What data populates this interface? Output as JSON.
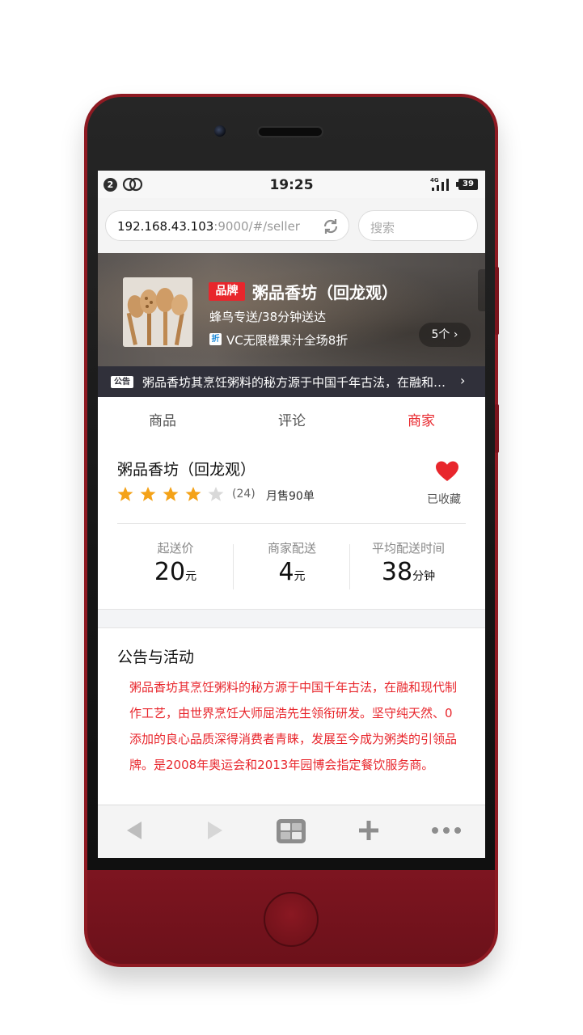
{
  "statusbar": {
    "notification_count": "2",
    "time": "19:25",
    "network": "4G",
    "battery": "39"
  },
  "addressbar": {
    "url_host": "192.168.43.103",
    "url_path": ":9000/#/seller",
    "search_placeholder": "搜索"
  },
  "seller_header": {
    "brand_badge": "品牌",
    "name": "粥品香坊（回龙观）",
    "delivery": "蜂鸟专送/38分钟送达",
    "promo_icon": "折",
    "promo": "VC无限橙果汁全场8折",
    "promo_count": "5个",
    "promo_arrow": "›"
  },
  "notice": {
    "badge": "公告",
    "text": "粥品香坊其烹饪粥料的秘方源于中国千年古法，在融和现代制作工艺，由世界烹饪大师屈浩先生领衔研发。",
    "arrow": "›"
  },
  "tabs": [
    {
      "label": "商品"
    },
    {
      "label": "评论"
    },
    {
      "label": "商家"
    }
  ],
  "seller": {
    "name": "粥品香坊（回龙观）",
    "stars": 4,
    "stars_max": 5,
    "rating_count": "(24)",
    "monthly_sales": "月售90单",
    "favorite_label": "已收藏",
    "metrics": [
      {
        "label": "起送价",
        "value": "20",
        "unit": "元"
      },
      {
        "label": "商家配送",
        "value": "4",
        "unit": "元"
      },
      {
        "label": "平均配送时间",
        "value": "38",
        "unit": "分钟"
      }
    ]
  },
  "bulletin": {
    "title": "公告与活动",
    "text": "粥品香坊其烹饪粥料的秘方源于中国千年古法，在融和现代制作工艺，由世界烹饪大师屈浩先生领衔研发。坚守纯天然、0添加的良心品质深得消费者青睐，发展至今成为粥类的引领品牌。是2008年奥运会和2013年园博会指定餐饮服务商。"
  },
  "colors": {
    "accent": "#e8262c",
    "phone_body": "#8e1a22",
    "notice_bg": "#30303a",
    "star": "#f4a218",
    "star_empty": "#d9d9d9"
  },
  "icons": {
    "back": "back-arrow-icon",
    "forward": "forward-arrow-icon",
    "tabs": "tabs-window-icon",
    "add": "plus-icon",
    "more": "more-dots-icon",
    "reload": "reload-icon",
    "favorite": "heart-icon"
  }
}
